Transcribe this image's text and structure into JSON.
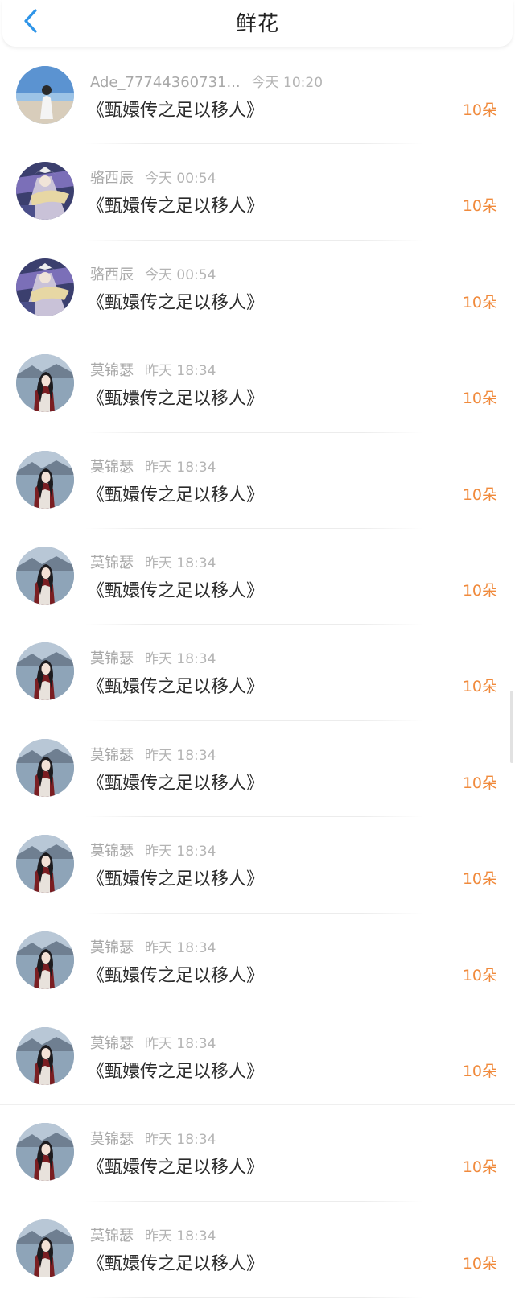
{
  "header": {
    "title": "鲜花",
    "back_icon": "chevron-left-icon",
    "accent_color": "#2f95e8"
  },
  "colors": {
    "amount": "#f08a3c",
    "name": "#a8a8a8",
    "book_title": "#2b2b2b"
  },
  "rows": [
    {
      "avatar": "beach-person",
      "name": "Ade_77744360731...",
      "time": "今天 10:20",
      "book": "《甄嬛传之足以移人》",
      "amount": "10朵"
    },
    {
      "avatar": "anime-warrior",
      "name": "骆西辰",
      "time": "今天 00:54",
      "book": "《甄嬛传之足以移人》",
      "amount": "10朵"
    },
    {
      "avatar": "anime-warrior",
      "name": "骆西辰",
      "time": "今天 00:54",
      "book": "《甄嬛传之足以移人》",
      "amount": "10朵"
    },
    {
      "avatar": "woman-seaside",
      "name": "莫锦瑟",
      "time": "昨天 18:34",
      "book": "《甄嬛传之足以移人》",
      "amount": "10朵"
    },
    {
      "avatar": "woman-seaside",
      "name": "莫锦瑟",
      "time": "昨天 18:34",
      "book": "《甄嬛传之足以移人》",
      "amount": "10朵"
    },
    {
      "avatar": "woman-seaside",
      "name": "莫锦瑟",
      "time": "昨天 18:34",
      "book": "《甄嬛传之足以移人》",
      "amount": "10朵"
    },
    {
      "avatar": "woman-seaside",
      "name": "莫锦瑟",
      "time": "昨天 18:34",
      "book": "《甄嬛传之足以移人》",
      "amount": "10朵"
    },
    {
      "avatar": "woman-seaside",
      "name": "莫锦瑟",
      "time": "昨天 18:34",
      "book": "《甄嬛传之足以移人》",
      "amount": "10朵"
    },
    {
      "avatar": "woman-seaside",
      "name": "莫锦瑟",
      "time": "昨天 18:34",
      "book": "《甄嬛传之足以移人》",
      "amount": "10朵"
    },
    {
      "avatar": "woman-seaside",
      "name": "莫锦瑟",
      "time": "昨天 18:34",
      "book": "《甄嬛传之足以移人》",
      "amount": "10朵"
    },
    {
      "avatar": "woman-seaside",
      "name": "莫锦瑟",
      "time": "昨天 18:34",
      "book": "《甄嬛传之足以移人》",
      "amount": "10朵"
    },
    {
      "avatar": "woman-seaside",
      "name": "莫锦瑟",
      "time": "昨天 18:34",
      "book": "《甄嬛传之足以移人》",
      "amount": "10朵"
    },
    {
      "avatar": "woman-seaside",
      "name": "莫锦瑟",
      "time": "昨天 18:34",
      "book": "《甄嬛传之足以移人》",
      "amount": "10朵"
    }
  ]
}
